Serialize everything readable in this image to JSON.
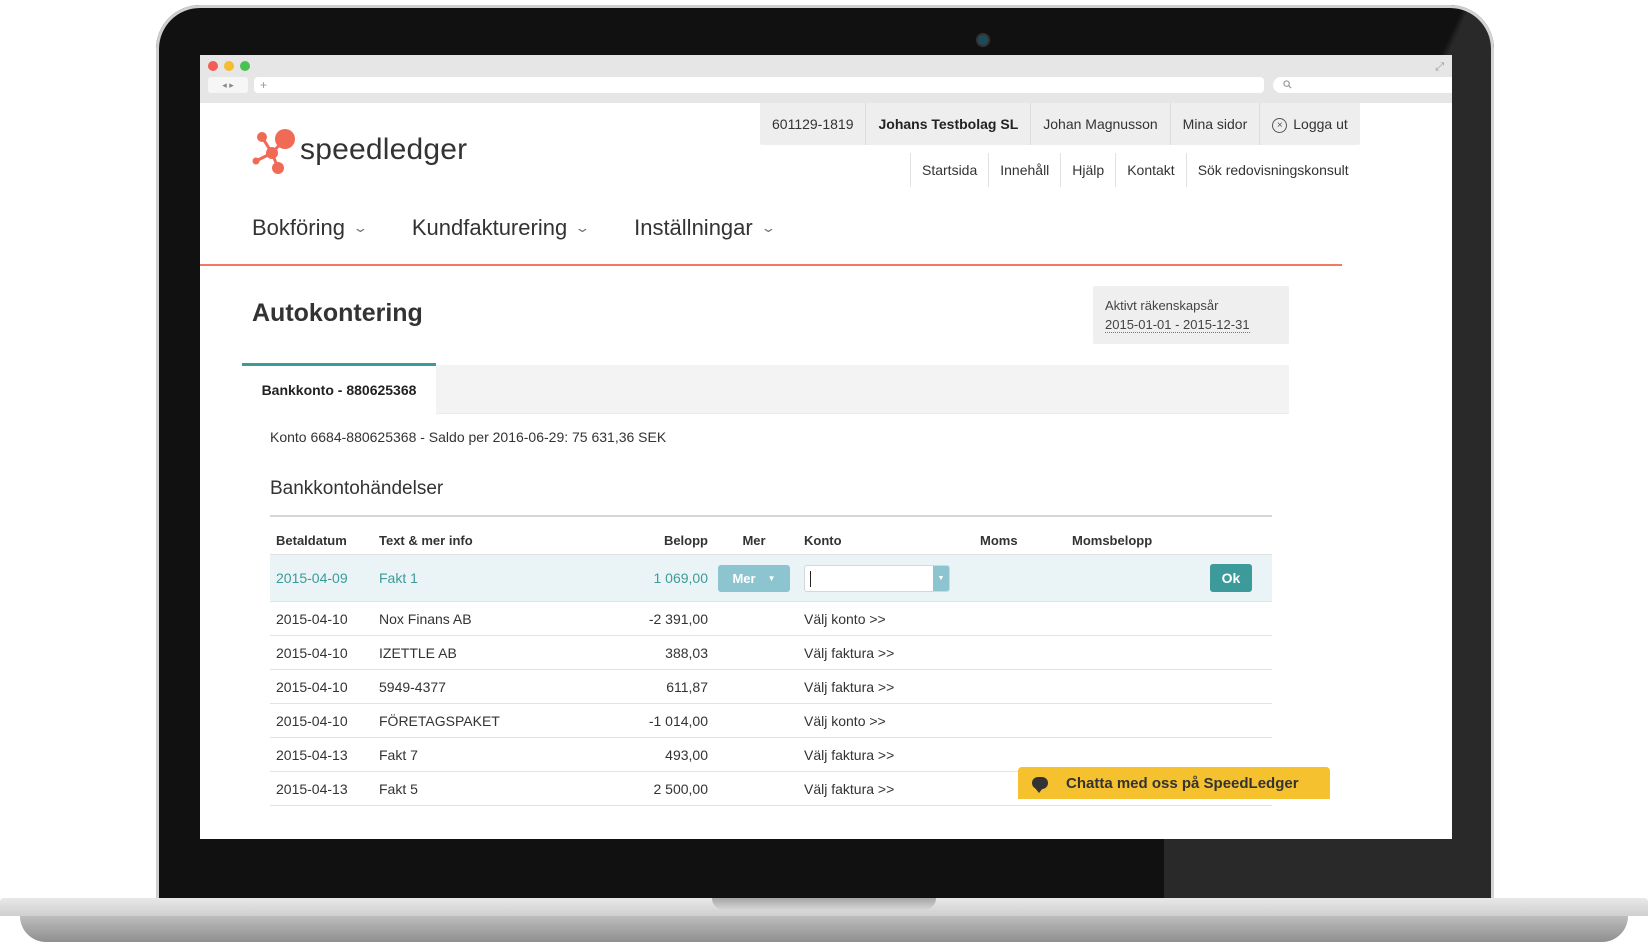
{
  "browser": {
    "nav_arrows": "◂  ▸",
    "new_tab": "+",
    "search_icon": "magnifier-icon"
  },
  "user_bar": {
    "org_number": "601129-1819",
    "company": "Johans Testbolag SL",
    "user_name": "Johan Magnusson",
    "my_pages": "Mina sidor",
    "logout": "Logga ut"
  },
  "secondary_nav": [
    "Startsida",
    "Innehåll",
    "Hjälp",
    "Kontakt",
    "Sök redovisningskonsult"
  ],
  "logo": {
    "text": "speedledger",
    "brand_color": "#f06a55"
  },
  "main_nav": [
    "Bokföring",
    "Kundfakturering",
    "Inställningar"
  ],
  "page": {
    "title": "Autokontering",
    "fiscal_label": "Aktivt räkenskapsår",
    "fiscal_range": "2015-01-01 - 2015-12-31",
    "tab": "Bankkonto - 880625368",
    "account_line": "Konto 6684-880625368 - Saldo per 2016-06-29: 75 631,36 SEK",
    "section_title": "Bankkontohändelser"
  },
  "table": {
    "headers": {
      "date": "Betaldatum",
      "text": "Text & mer info",
      "amount": "Belopp",
      "more": "Mer",
      "account": "Konto",
      "vat": "Moms",
      "vat_amount": "Momsbelopp"
    },
    "selected_row": {
      "date": "2015-04-09",
      "text": "Fakt 1",
      "amount": "1 069,00",
      "more_button": "Mer",
      "ok_button": "Ok"
    },
    "rows": [
      {
        "date": "2015-04-10",
        "text": "Nox Finans AB",
        "amount": "-2 391,00",
        "action": "Välj konto >>"
      },
      {
        "date": "2015-04-10",
        "text": "IZETTLE AB",
        "amount": "388,03",
        "action": "Välj faktura >>"
      },
      {
        "date": "2015-04-10",
        "text": "5949-4377",
        "amount": "611,87",
        "action": "Välj faktura >>"
      },
      {
        "date": "2015-04-10",
        "text": "FÖRETAGSPAKET",
        "amount": "-1 014,00",
        "action": "Välj konto >>"
      },
      {
        "date": "2015-04-13",
        "text": "Fakt 7",
        "amount": "493,00",
        "action": "Välj faktura >>"
      },
      {
        "date": "2015-04-13",
        "text": "Fakt 5",
        "amount": "2 500,00",
        "action": "Välj faktura >>"
      }
    ]
  },
  "chat": {
    "label": "Chatta med oss på SpeedLedger"
  },
  "colors": {
    "accent": "#3d9a9a",
    "nav_divider": "#f07a62",
    "chat": "#f6c12f"
  }
}
